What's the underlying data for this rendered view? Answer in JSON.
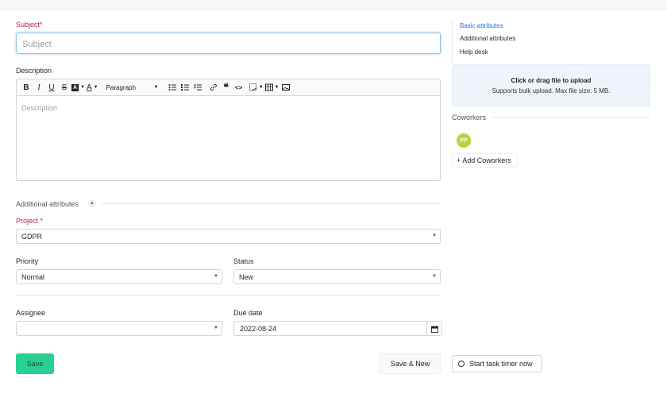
{
  "form": {
    "subject_label": "Subject",
    "subject_required": "*",
    "subject_placeholder": "Subject",
    "description_label": "Description",
    "description_placeholder": "Description",
    "toolbar": {
      "paragraph_label": "Paragraph"
    },
    "additional_attributes_label": "Additional attributes",
    "project_label": "Project",
    "project_required": "*",
    "project_value": "GDPR",
    "priority_label": "Priority",
    "priority_value": "Normal",
    "status_label": "Status",
    "status_value": "New",
    "assignee_label": "Assignee",
    "assignee_value": "",
    "due_date_label": "Due date",
    "due_date_value": "2022-08-24"
  },
  "buttons": {
    "save": "Save",
    "save_new": "Save & New",
    "start_timer": "Start task timer now"
  },
  "sidebar": {
    "links": [
      {
        "label": "Basic attributes",
        "active": true
      },
      {
        "label": "Additional attributes",
        "active": false
      },
      {
        "label": "Help desk",
        "active": false
      }
    ],
    "upload_title": "Click or drag file to upload",
    "upload_hint": "Supports bulk upload. Max file size: 5 MB.",
    "coworkers_label": "Coworkers",
    "avatar_initials": "PP",
    "add_coworkers_label": "+ Add Coworkers"
  },
  "colors": {
    "accent_link": "#1f6feb",
    "save_button": "#28d193",
    "required": "#c2185b",
    "avatar": "#c3cf3a"
  }
}
